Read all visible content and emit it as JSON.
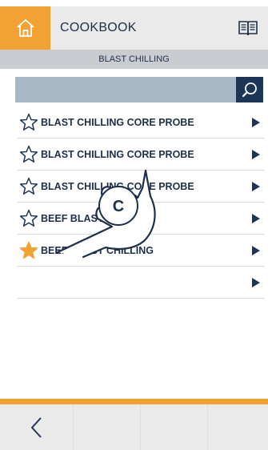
{
  "header": {
    "title": "COOKBOOK",
    "home_icon": "home-icon",
    "book_icon": "book-icon"
  },
  "subheader": {
    "title": "BLAST CHILLING"
  },
  "search": {
    "value": "",
    "placeholder": ""
  },
  "recipes": [
    {
      "name": "BLAST CHILLING CORE PROBE",
      "favorite": false
    },
    {
      "name": "BLAST CHILLING CORE PROBE",
      "favorite": false
    },
    {
      "name": "BLAST CHILLING CORE PROBE",
      "favorite": false
    },
    {
      "name": "BEEF BLAST CHILLING",
      "favorite": false
    },
    {
      "name": "BEEF BLAST CHILLING",
      "favorite": true
    },
    {
      "name": "",
      "favorite": false
    }
  ],
  "overlay": {
    "gesture_letter": "C"
  },
  "colors": {
    "accent": "#f2a233",
    "navy": "#1d3557",
    "search_bg": "#a9b8c6"
  }
}
